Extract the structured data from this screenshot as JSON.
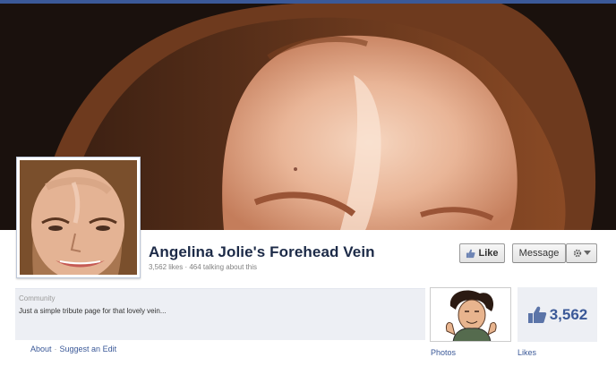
{
  "page": {
    "name": "Angelina Jolie's Forehead Vein",
    "stats": "3,562 likes · 464 talking about this"
  },
  "actions": {
    "like_label": "Like",
    "message_label": "Message"
  },
  "about": {
    "category": "Community",
    "description": "Just a simple tribute page for that lovely vein..."
  },
  "footer": {
    "about_link": "About",
    "separator": "·",
    "suggest_link": "Suggest an Edit"
  },
  "apps": {
    "photos_label": "Photos",
    "likes_label": "Likes",
    "likes_count": "3,562"
  },
  "icons": [
    "thumbs-up-icon",
    "gear-icon",
    "caret-down-icon"
  ],
  "colors": {
    "brand_blue": "#3b5998",
    "title_color": "#1c2a47",
    "panel_bg": "#edeff4"
  }
}
